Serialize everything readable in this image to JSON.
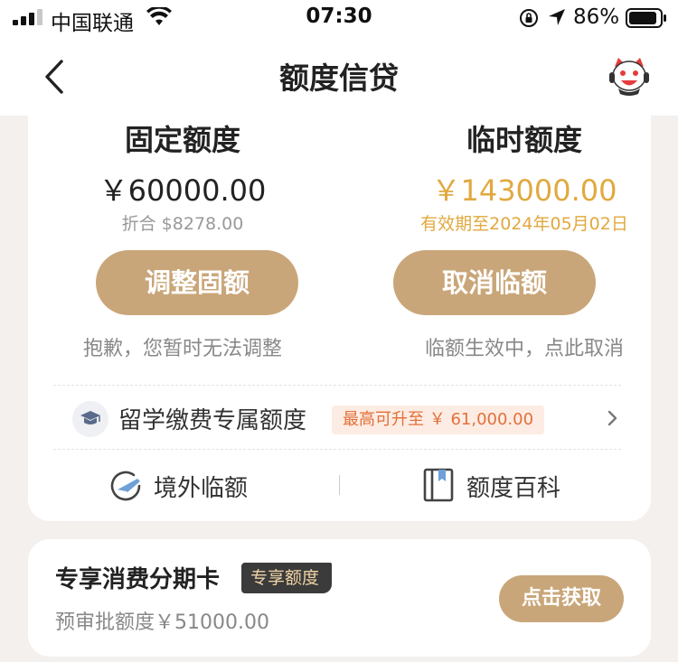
{
  "status_bar": {
    "carrier": "中国联通",
    "time": "07:30",
    "battery": "86%"
  },
  "nav": {
    "title": "额度信贷",
    "back_icon": "chevron-left-icon",
    "mascot_icon": "mascot-avatar-icon"
  },
  "fixed_limit": {
    "title": "固定额度",
    "amount": "￥60000.00",
    "converted": "折合 $8278.00",
    "button": "调整固额",
    "note": "抱歉，您暂时无法调整"
  },
  "temp_limit": {
    "title": "临时额度",
    "amount": "￥143000.00",
    "validity": "有效期至2024年05月02日",
    "button": "取消临额",
    "note": "临额生效中，点此取消"
  },
  "study_row": {
    "label": "留学缴费专属额度",
    "badge": "最高可升至 ￥ 61,000.00",
    "icon": "graduation-cap-icon"
  },
  "links": {
    "overseas": "境外临额",
    "encyclopedia": "额度百科"
  },
  "installment_card": {
    "title": "专享消费分期卡",
    "tag": "专享额度",
    "preapproved": "预审批额度￥51000.00",
    "button": "点击获取"
  },
  "colors": {
    "accent": "#c9a679",
    "gold_text": "#e1a93f",
    "badge_text": "#e2703a",
    "badge_bg": "#fdece3",
    "background": "#f3f0ee"
  }
}
